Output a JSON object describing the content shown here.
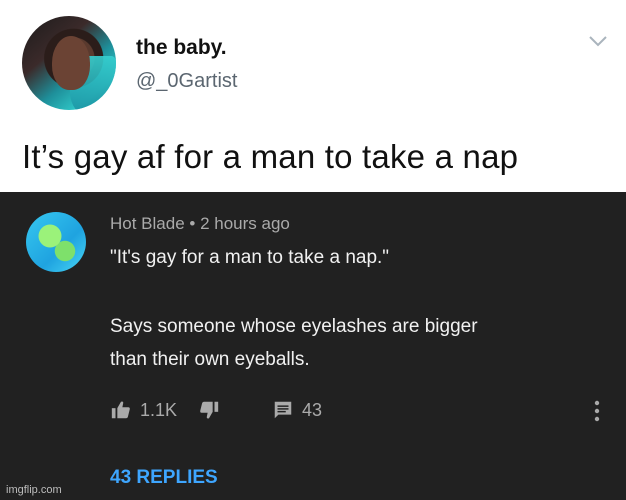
{
  "tweet": {
    "display_name": "the baby.",
    "handle": "@_0Gartist",
    "text": "It’s gay af for a man to take a nap"
  },
  "comment": {
    "author": "Hot Blade",
    "separator": "•",
    "time": "2 hours ago",
    "text_line1": "\"It's gay for a man to take a nap.\"",
    "text_line2": "Says someone whose eyelashes are bigger",
    "text_line3": "than their own eyeballs.",
    "likes": "1.1K",
    "reply_count": "43",
    "replies_link": "43 REPLIES"
  },
  "watermark": "imgflip.com",
  "colors": {
    "comment_bg": "#212121",
    "link_blue": "#3ea6ff",
    "muted_text": "#aaaaaa"
  }
}
